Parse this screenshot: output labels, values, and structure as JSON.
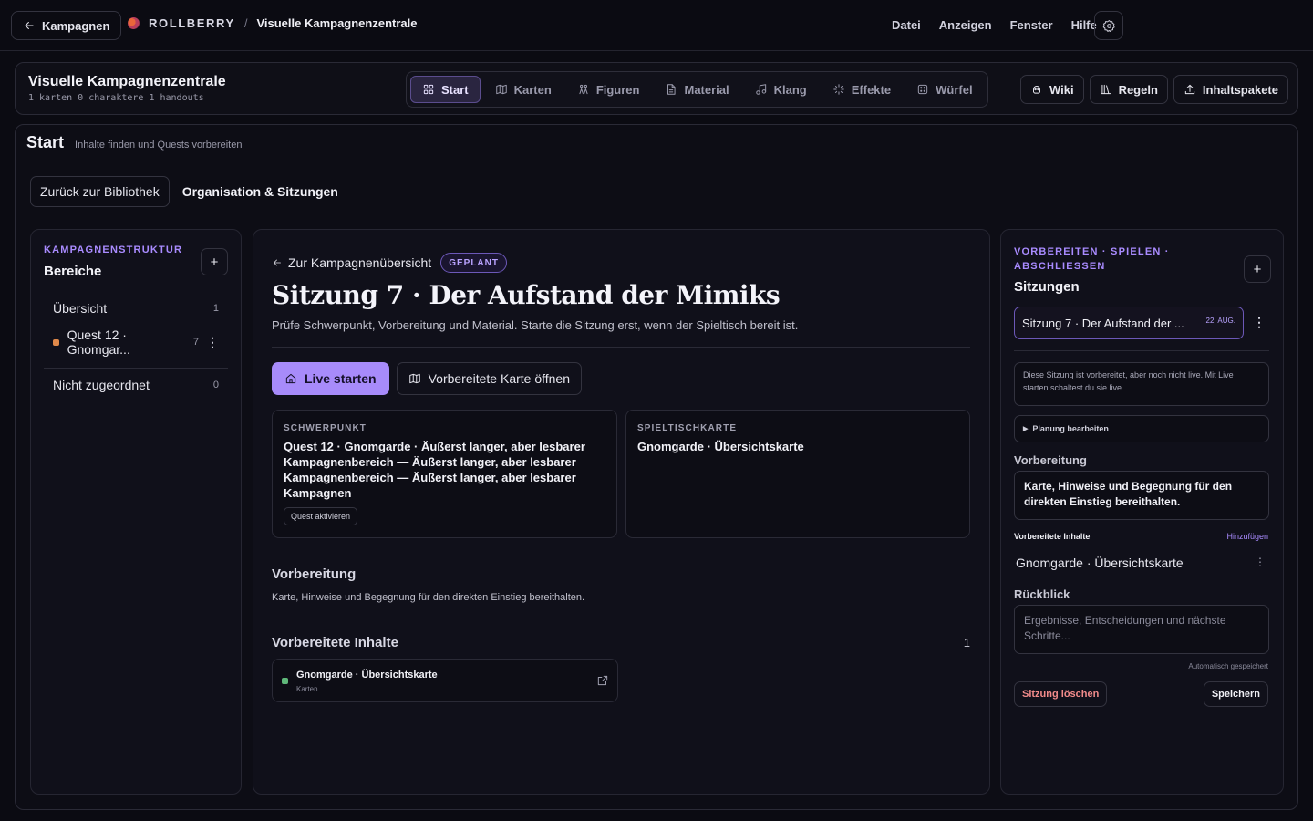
{
  "topbar": {
    "back_label": "Kampagnen",
    "brand_name": "ROLLBERRY",
    "separator": "/",
    "app_title": "Visuelle Kampagnenzentrale",
    "menu": [
      "Datei",
      "Anzeigen",
      "Fenster",
      "Hilfe"
    ]
  },
  "header": {
    "title": "Visuelle Kampagnenzentrale",
    "stats": "1 karten 0 charaktere 1 handouts",
    "tabs": [
      {
        "label": "Start",
        "icon": "grid-icon",
        "active": true
      },
      {
        "label": "Karten",
        "icon": "map-icon"
      },
      {
        "label": "Figuren",
        "icon": "figures-icon"
      },
      {
        "label": "Material",
        "icon": "document-icon"
      },
      {
        "label": "Klang",
        "icon": "music-icon"
      },
      {
        "label": "Effekte",
        "icon": "sparkle-icon"
      },
      {
        "label": "Würfel",
        "icon": "dice-icon"
      }
    ],
    "buttons": [
      {
        "label": "Wiki",
        "icon": "skull-icon"
      },
      {
        "label": "Regeln",
        "icon": "library-icon"
      },
      {
        "label": "Inhaltspakete",
        "icon": "upload-icon"
      }
    ]
  },
  "main": {
    "title": "Start",
    "subtitle": "Inhalte finden und Quests vorbereiten",
    "back_library": "Zurück zur Bibliothek",
    "section_label": "Organisation & Sitzungen"
  },
  "left": {
    "kicker": "KAMPAGNENSTRUKTUR",
    "title": "Bereiche",
    "add": "+",
    "items": [
      {
        "label": "Übersicht",
        "count": "1"
      },
      {
        "label": "Quest 12 · Gnomgar...",
        "count": "7",
        "color": "#e0894a"
      },
      {
        "label": "Nicht zugeordnet",
        "count": "0"
      }
    ]
  },
  "center": {
    "back_link": "Zur Kampagnenübersicht",
    "status": "GEPLANT",
    "title": "Sitzung 7 · Der Aufstand der Mimiks",
    "description": "Prüfe Schwerpunkt, Vorbereitung und Material. Starte die Sitzung erst, wenn der Spieltisch bereit ist.",
    "live_button": "Live starten",
    "open_map_button": "Vorbereitete Karte öffnen",
    "focus": {
      "kicker": "SCHWERPUNKT",
      "text": "Quest 12 · Gnomgarde · Äußerst langer, aber lesbarer Kampagnenbereich — Äußerst langer, aber lesbarer Kampagnenbereich — Äußerst langer, aber lesbarer Kampagnen",
      "button": "Quest aktivieren"
    },
    "table_map": {
      "kicker": "SPIELTISCHKARTE",
      "text": "Gnomgarde · Übersichtskarte"
    },
    "prep_title": "Vorbereitung",
    "prep_text": "Karte, Hinweise und Begegnung für den direkten Einstieg bereithalten.",
    "content_title": "Vorbereitete Inhalte",
    "content_count": "1",
    "content_item": {
      "title": "Gnomgarde · Übersichtskarte",
      "type": "Karten",
      "color": "#5fb87a"
    }
  },
  "right": {
    "kicker": "VORBEREITEN · SPIELEN · ABSCHLIESSEN",
    "title": "Sitzungen",
    "add": "+",
    "session": {
      "label": "Sitzung 7 · Der Aufstand der ...",
      "date": "22. AUG."
    },
    "info": "Diese Sitzung ist vorbereitet, aber noch nicht live. Mit Live starten schaltest du sie live.",
    "planning": "Planung bearbeiten",
    "prep_label": "Vorbereitung",
    "prep_value": "Karte, Hinweise und Begegnung für den direkten Einstieg bereithalten.",
    "content_label": "Vorbereitete Inhalte",
    "add_link": "Hinzufügen",
    "content_item": "Gnomgarde · Übersichtskarte",
    "review_label": "Rückblick",
    "review_placeholder": "Ergebnisse, Entscheidungen und nächste Schritte...",
    "autosave": "Automatisch gespeichert",
    "delete_button": "Sitzung löschen",
    "save_button": "Speichern"
  }
}
